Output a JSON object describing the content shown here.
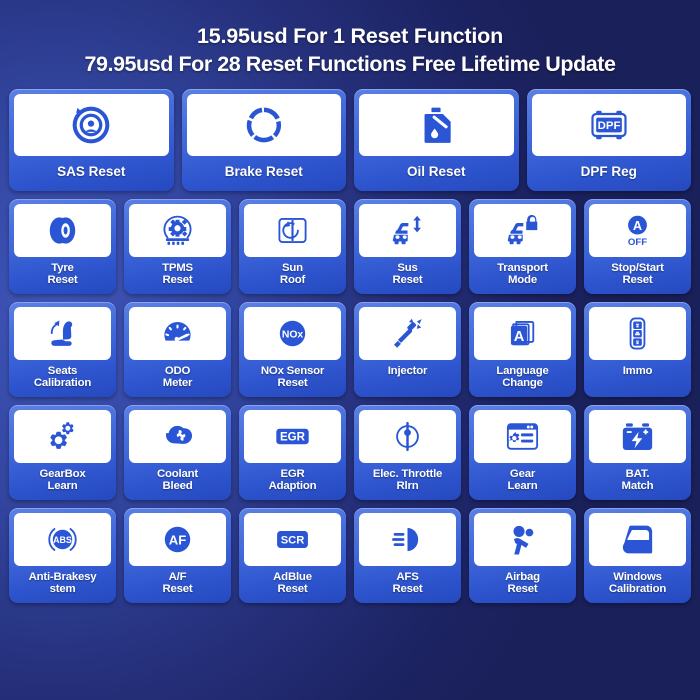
{
  "header": {
    "line1": "15.95usd For 1 Reset Function",
    "line2": "79.95usd  For 28 Reset Functions Free Lifetime Update"
  },
  "theme": {
    "background_dark": "#1b2363",
    "background_light": "#3f55b8",
    "card_gradient_top": "#5c80e4",
    "card_gradient_bottom": "#2549bf",
    "icon_color": "#2a56d6",
    "plate_color": "#ffffff",
    "text_color": "#ffffff"
  },
  "rows": [
    {
      "columns": 4,
      "cards": [
        {
          "label": "SAS Reset",
          "icon": "steering-wheel-icon"
        },
        {
          "label": "Brake Reset",
          "icon": "brake-disc-icon"
        },
        {
          "label": "Oil Reset",
          "icon": "oil-can-icon"
        },
        {
          "label": "DPF Reg",
          "icon": "dpf-filter-icon"
        }
      ]
    },
    {
      "columns": 6,
      "cards": [
        {
          "label": "Tyre\nReset",
          "icon": "tyre-icon"
        },
        {
          "label": "TPMS\nReset",
          "icon": "tpms-sensor-icon"
        },
        {
          "label": "Sun\nRoof",
          "icon": "sunroof-icon"
        },
        {
          "label": "Sus\nReset",
          "icon": "suspension-car-icon"
        },
        {
          "label": "Transport\nMode",
          "icon": "transport-lock-car-icon"
        },
        {
          "label": "Stop/Start\nReset",
          "icon": "auto-stop-start-icon"
        }
      ]
    },
    {
      "columns": 6,
      "cards": [
        {
          "label": "Seats\nCalibration",
          "icon": "car-seat-icon"
        },
        {
          "label": "ODO\nMeter",
          "icon": "odometer-gauge-icon"
        },
        {
          "label": "NOx Sensor\nReset",
          "icon": "nox-sensor-icon"
        },
        {
          "label": "Injector",
          "icon": "fuel-injector-icon"
        },
        {
          "label": "Language\nChange",
          "icon": "language-book-icon"
        },
        {
          "label": "Immo",
          "icon": "car-key-fob-icon"
        }
      ]
    },
    {
      "columns": 6,
      "cards": [
        {
          "label": "GearBox\nLearn",
          "icon": "gears-icon"
        },
        {
          "label": "Coolant\nBleed",
          "icon": "coolant-fan-icon"
        },
        {
          "label": "EGR\nAdaption",
          "icon": "egr-badge-icon"
        },
        {
          "label": "Elec. Throttle\nRlrn",
          "icon": "throttle-body-icon"
        },
        {
          "label": "Gear\nLearn",
          "icon": "gear-learn-window-icon"
        },
        {
          "label": "BAT.\nMatch",
          "icon": "battery-icon"
        }
      ]
    },
    {
      "columns": 6,
      "cards": [
        {
          "label": "Anti-Brakesy\nstem",
          "icon": "abs-icon"
        },
        {
          "label": "A/F\nReset",
          "icon": "af-badge-icon"
        },
        {
          "label": "AdBlue\nReset",
          "icon": "scr-badge-icon"
        },
        {
          "label": "AFS\nReset",
          "icon": "headlight-icon"
        },
        {
          "label": "Airbag\nReset",
          "icon": "airbag-seatbelt-icon"
        },
        {
          "label": "Windows\nCalibration",
          "icon": "car-door-window-icon"
        }
      ]
    }
  ]
}
